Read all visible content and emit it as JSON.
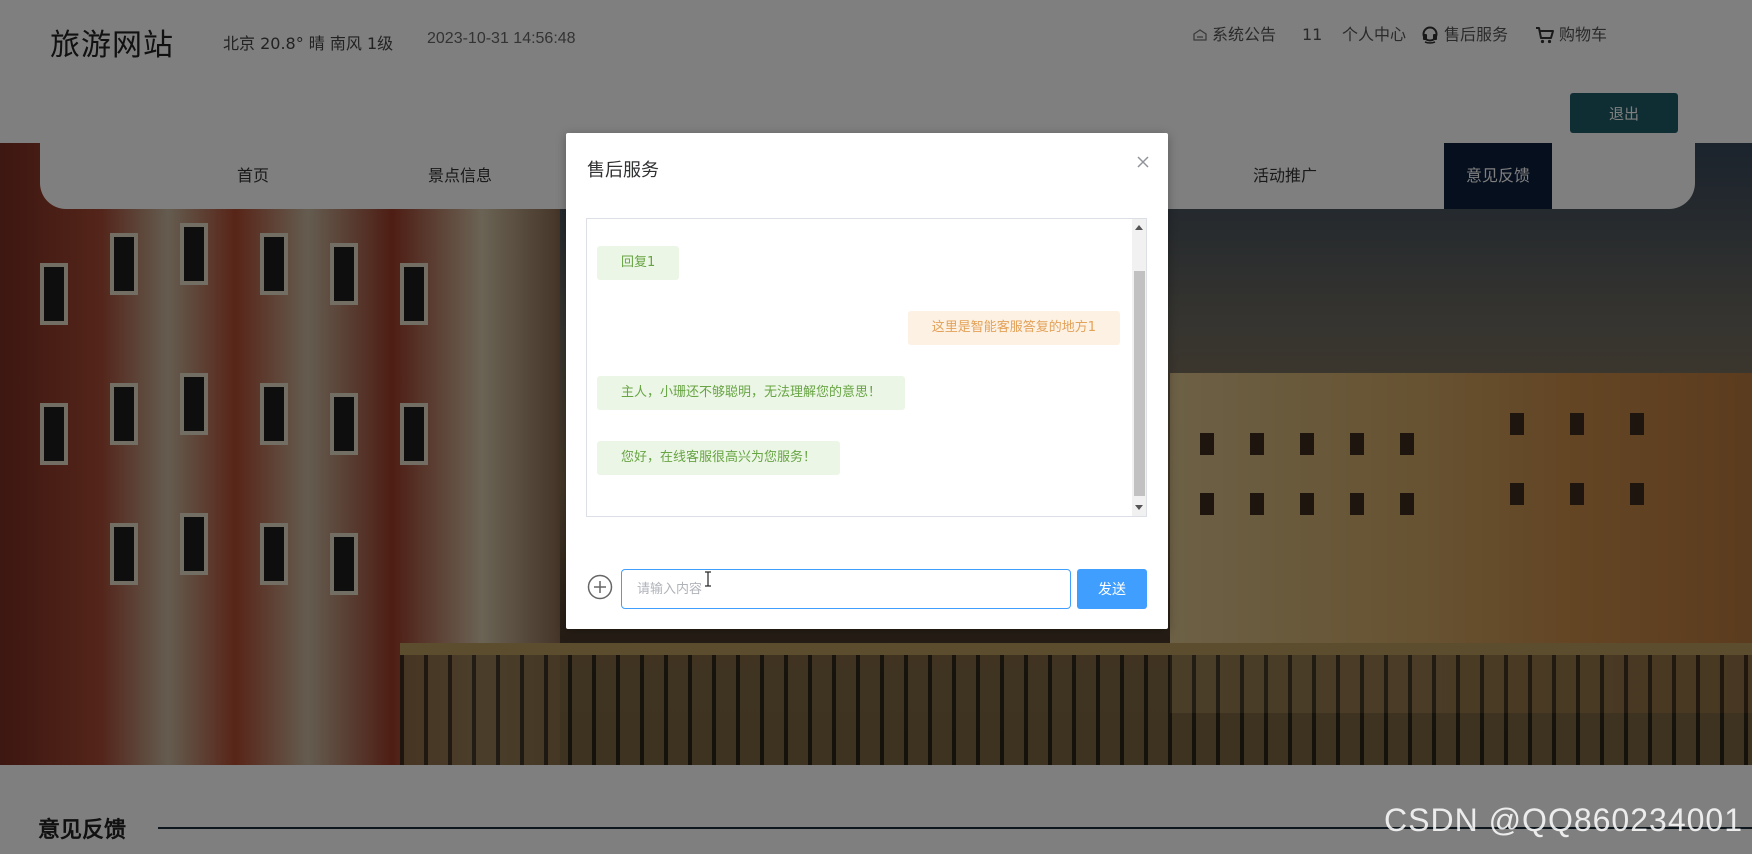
{
  "header": {
    "site_title": "旅游网站",
    "weather": "北京  20.8°  晴  南风  1级",
    "datetime": "2023-10-31 14:56:48",
    "links": {
      "announcement": "系统公告",
      "count": "11",
      "personal_center": "个人中心",
      "after_sales": "售后服务",
      "cart": "购物车"
    },
    "logout": "退出"
  },
  "nav": {
    "items": [
      "首页",
      "景点信息",
      "活动推广",
      "意见反馈"
    ],
    "active": "意见反馈"
  },
  "section": {
    "title": "意见反馈"
  },
  "dialog": {
    "title": "售后服务",
    "messages": [
      {
        "from": "bot",
        "text": "回复1"
      },
      {
        "from": "user",
        "text": "这里是智能客服答复的地方1"
      },
      {
        "from": "bot",
        "text": "主人，小珊还不够聪明，无法理解您的意思！"
      },
      {
        "from": "bot",
        "text": "您好，在线客服很高兴为您服务！"
      }
    ],
    "input_placeholder": "请输入内容",
    "send": "发送"
  },
  "watermark": "CSDN @QQ860234001",
  "colors": {
    "accent": "#409eff",
    "logout_bg": "#1e5d68",
    "nav_active_bg": "#0d1f3c",
    "bot_bubble_bg": "#ecf6e6",
    "bot_bubble_text": "#67a443",
    "user_bubble_bg": "#fdf1e3",
    "user_bubble_text": "#e3a258"
  }
}
